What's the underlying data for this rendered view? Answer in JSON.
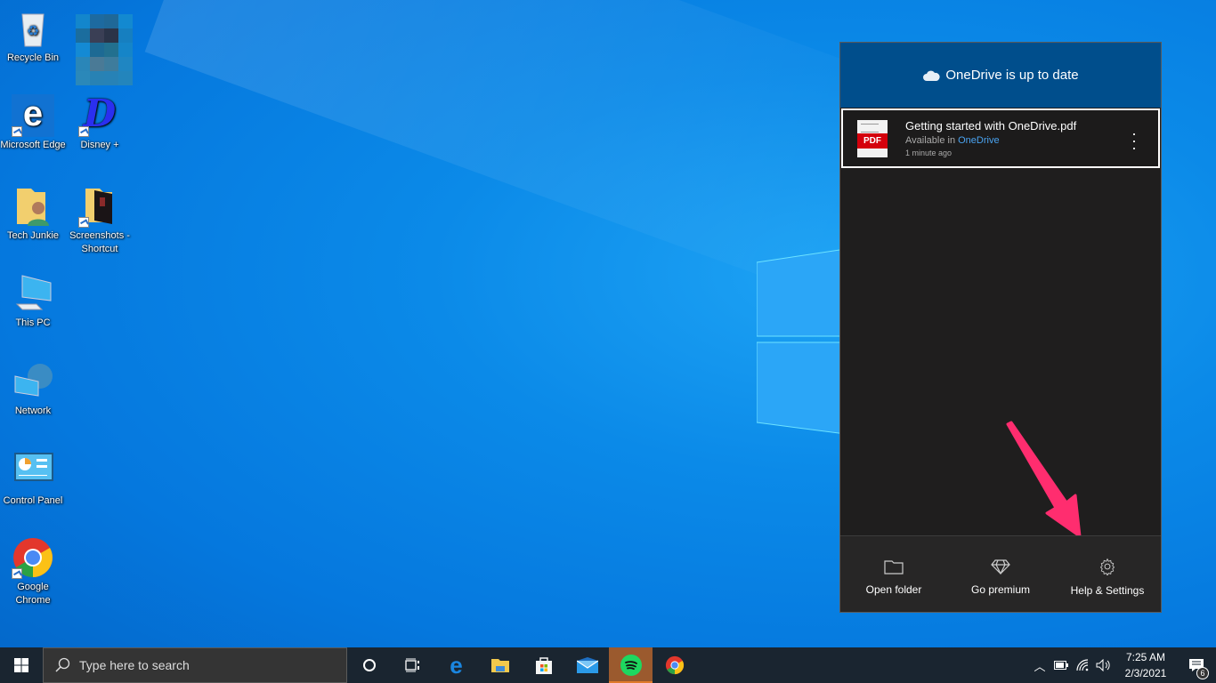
{
  "desktop": {
    "icons": [
      {
        "label": "Recycle Bin",
        "icon": "recycle-bin-icon",
        "shortcut": false
      },
      {
        "label": "",
        "icon": "pixelated-icon",
        "shortcut": false
      },
      {
        "label": "Microsoft Edge",
        "icon": "edge-icon",
        "shortcut": true
      },
      {
        "label": "Disney +",
        "icon": "disney-icon",
        "shortcut": true
      },
      {
        "label": "Tech Junkie",
        "icon": "user-folder-icon",
        "shortcut": false
      },
      {
        "label": "Screenshots - Shortcut",
        "icon": "folder-icon",
        "shortcut": true
      },
      {
        "label": "This PC",
        "icon": "computer-icon",
        "shortcut": false
      },
      {
        "label": "Network",
        "icon": "network-icon",
        "shortcut": false
      },
      {
        "label": "Control Panel",
        "icon": "control-panel-icon",
        "shortcut": false
      },
      {
        "label": "Google Chrome",
        "icon": "chrome-icon",
        "shortcut": true
      }
    ]
  },
  "onedrive": {
    "status": "OneDrive is up to date",
    "files": [
      {
        "name": "Getting started with OneDrive.pdf",
        "location_prefix": "Available in",
        "location": "OneDrive",
        "time": "1 minute ago",
        "type_label": "PDF"
      }
    ],
    "footer": [
      {
        "label": "Open folder",
        "icon": "folder-icon"
      },
      {
        "label": "Go premium",
        "icon": "diamond-icon"
      },
      {
        "label": "Help & Settings",
        "icon": "gear-icon"
      }
    ],
    "annotation_color": "#ff2d6f"
  },
  "taskbar": {
    "search_placeholder": "Type here to search",
    "apps": [
      "cortana",
      "task-view",
      "edge",
      "file-explorer",
      "store",
      "mail",
      "spotify",
      "chrome"
    ],
    "active_app": "spotify",
    "clock_time": "7:25 AM",
    "clock_date": "2/3/2021",
    "notification_count": "6"
  }
}
